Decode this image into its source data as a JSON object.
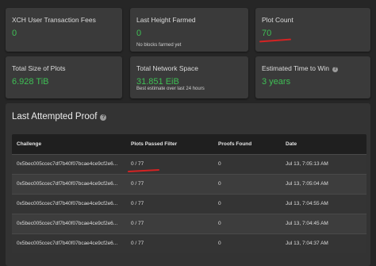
{
  "cards": {
    "fees": {
      "label": "XCH User Transaction Fees",
      "value": "0"
    },
    "height": {
      "label": "Last Height Farmed",
      "value": "0",
      "sub": "No blocks farmed yet"
    },
    "plots": {
      "label": "Plot Count",
      "value": "70"
    },
    "size": {
      "label": "Total Size of Plots",
      "value": "6.928 TiB"
    },
    "network": {
      "label": "Total Network Space",
      "value": "31.851 EiB",
      "sub": "Best estimate over last 24 hours"
    },
    "eta": {
      "label": "Estimated Time to Win",
      "value": "3 years",
      "help_icon": "question-circle-icon"
    }
  },
  "proof": {
    "title": "Last Attempted Proof",
    "help_icon": "question-circle-icon",
    "columns": [
      "Challenge",
      "Plots Passed Filter",
      "Proofs Found",
      "Date"
    ],
    "rows": [
      {
        "challenge": "0x5bec005ccec7df7b40f07bcae4ce9cf2e6...",
        "passed": "0 / 77",
        "proofs": "0",
        "date": "Jul 13, 7:05:13 AM"
      },
      {
        "challenge": "0x5bec005ccec7df7b40f07bcae4ce9cf2e6...",
        "passed": "0 / 77",
        "proofs": "0",
        "date": "Jul 13, 7:05:04 AM"
      },
      {
        "challenge": "0x5bec005ccec7df7b40f07bcae4ce9cf2e6...",
        "passed": "0 / 77",
        "proofs": "0",
        "date": "Jul 13, 7:04:55 AM"
      },
      {
        "challenge": "0x5bec005ccec7df7b40f07bcae4ce9cf2e6...",
        "passed": "0 / 77",
        "proofs": "0",
        "date": "Jul 13, 7:04:45 AM"
      },
      {
        "challenge": "0x5bec005ccec7df7b40f07bcae4ce9cf2e6...",
        "passed": "0 / 77",
        "proofs": "0",
        "date": "Jul 13, 7:04:37 AM"
      }
    ]
  },
  "colors": {
    "accent_green": "#3fbf55",
    "annotation_red": "#d42323",
    "card_bg": "#3a3a3a",
    "page_bg": "#262626"
  }
}
